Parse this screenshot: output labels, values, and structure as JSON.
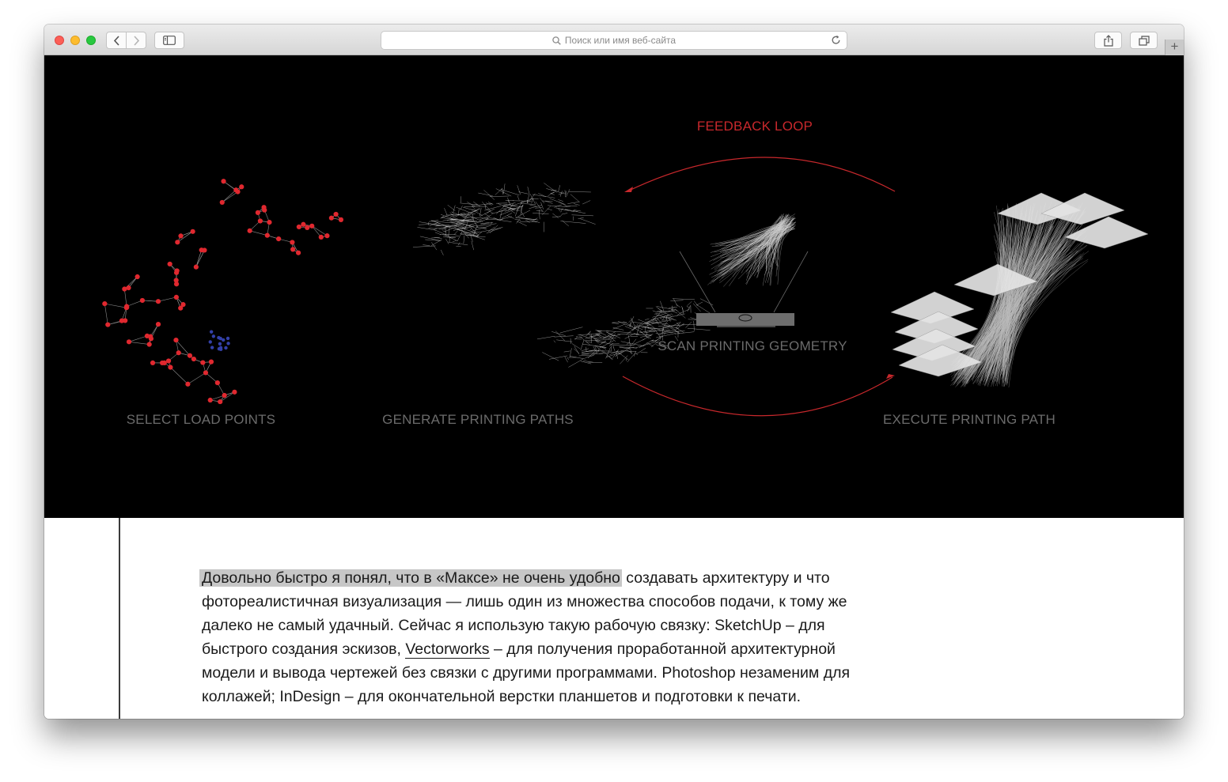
{
  "browser": {
    "address_placeholder": "Поиск или имя веб-сайта",
    "new_tab_symbol": "+",
    "buttons": {
      "back": "chevron-left-icon",
      "forward": "chevron-right-icon",
      "sidebar": "sidebar-icon",
      "share": "share-icon",
      "tabs": "tabs-icon",
      "reload": "reload-icon"
    }
  },
  "figure": {
    "feedback": "FEEDBACK LOOP",
    "steps": [
      "SELECT LOAD POINTS",
      "GENERATE PRINTING PATHS",
      "SCAN PRINTING GEOMETRY",
      "EXECUTE PRINTING PATH"
    ],
    "colors": {
      "feedback": "#c8282c",
      "points": "#e0282f",
      "anchor_points": "#3340a8",
      "label": "#6b6b6b"
    }
  },
  "article": {
    "highlighted": "Довольно быстро я понял, что в «Максе» не очень удобно",
    "text_1": " создавать архитектуру и что фотореалистичная визуализация — лишь один из множества способов подачи, к тому же далеко не самый удачный. Сейчас я использую такую рабочую связку: SketchUp – для быстрого создания эскизов, ",
    "link": "Vectorworks",
    "text_2": " – для получения проработанной архитектурной модели и вывода чертежей без связки с другими программами. Photoshop незаменим для коллажей; InDesign – для окончательной верстки планшетов и подготовки к печати."
  }
}
